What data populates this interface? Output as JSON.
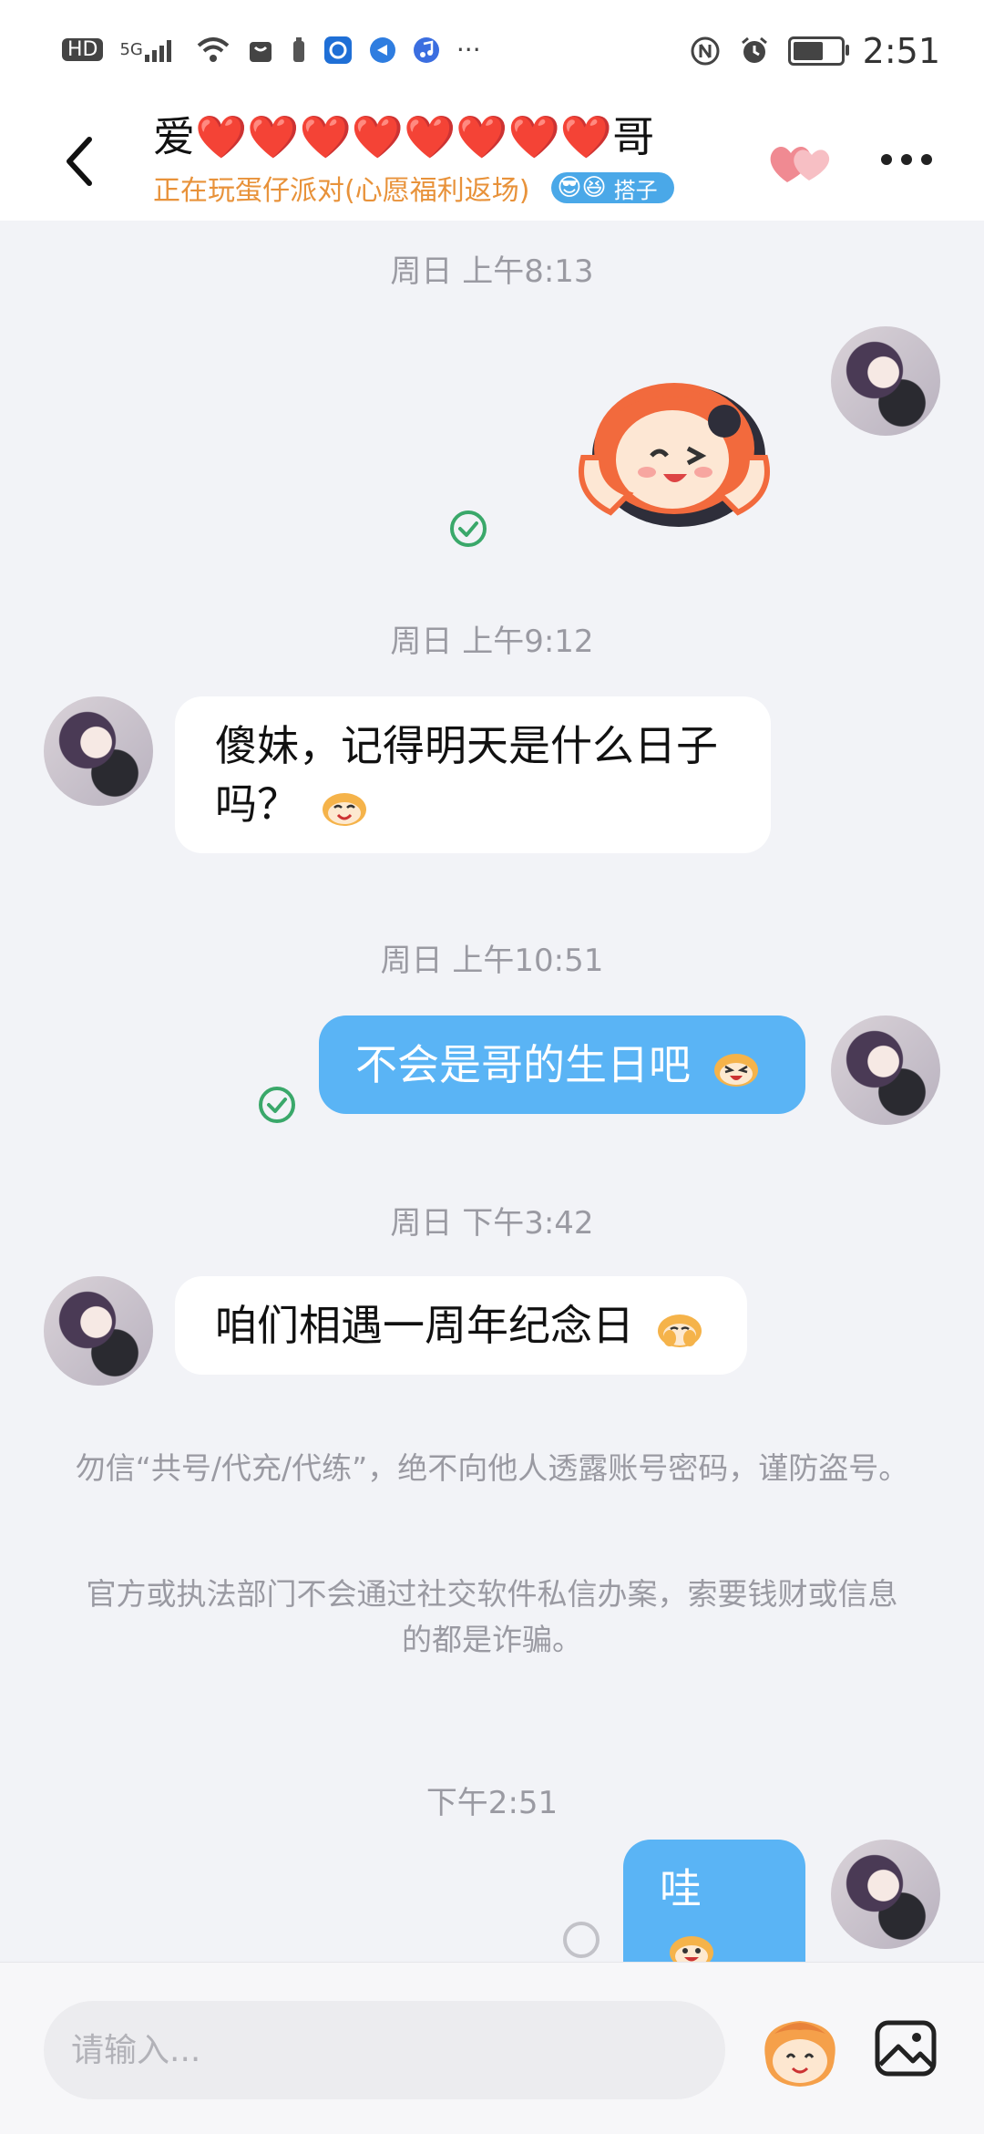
{
  "status_bar": {
    "hd": "HD",
    "signal": "5G",
    "more": "···",
    "time": "2:51"
  },
  "header": {
    "title": "爱❤️❤️❤️❤️❤️❤️❤️❤️哥",
    "subtitle": "正在玩蛋仔派对(心愿福利返场)",
    "badge_label": "搭子",
    "badge_emoji": "😎😆"
  },
  "messages": [
    {
      "time": "周日 上午8:13",
      "type": "sticker",
      "direction": "out",
      "status": "read"
    },
    {
      "time": "周日 上午9:12",
      "type": "text",
      "direction": "in",
      "text": "傻妹，记得明天是什么日子吗？"
    },
    {
      "time": "周日 上午10:51",
      "type": "text",
      "direction": "out",
      "text": "不会是哥的生日吧",
      "status": "read"
    },
    {
      "time": "周日 下午3:42",
      "type": "text",
      "direction": "in",
      "text": "咱们相遇一周年纪念日"
    },
    {
      "time": "下午2:51",
      "type": "text",
      "direction": "out",
      "text": "哇",
      "status": "sending"
    }
  ],
  "notices": [
    "勿信“共号/代充/代练”，绝不向他人透露账号密码，谨防盗号。",
    "官方或执法部门不会通过社交软件私信办案，索要钱财或信息的都是诈骗。"
  ],
  "input": {
    "placeholder": "请输入..."
  },
  "colors": {
    "outgoing_bubble": "#5ab4f5",
    "incoming_bubble": "#ffffff",
    "read_check": "#3aa86a",
    "subtitle": "#e8923a",
    "badge": "#4aa8e8"
  }
}
